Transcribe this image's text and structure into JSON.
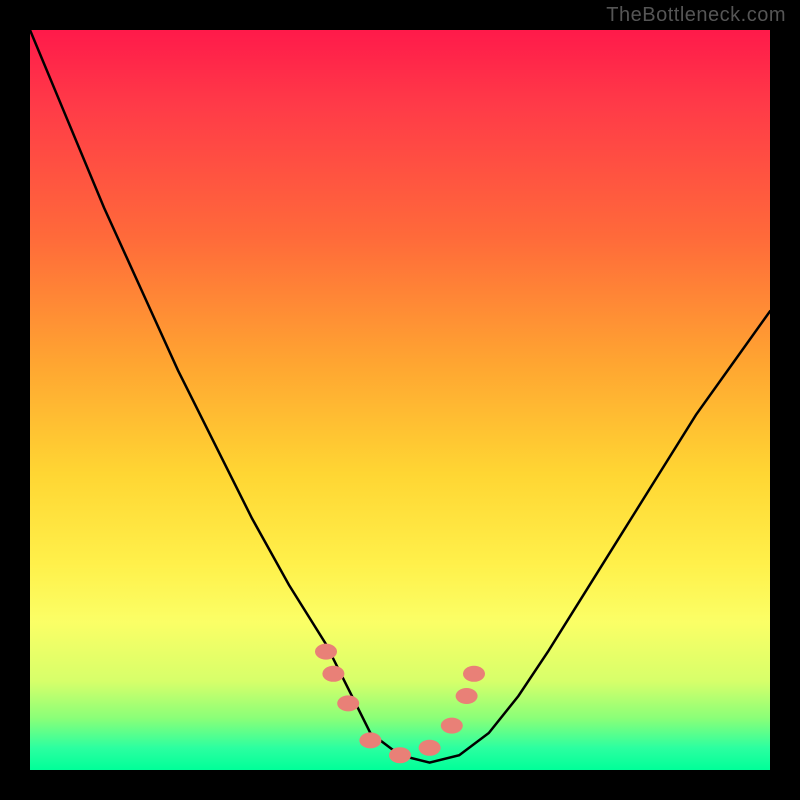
{
  "watermark": "TheBottleneck.com",
  "chart_data": {
    "type": "line",
    "title": "",
    "xlabel": "",
    "ylabel": "",
    "xlim": [
      0,
      100
    ],
    "ylim": [
      0,
      100
    ],
    "grid": false,
    "legend": false,
    "series": [
      {
        "name": "bottleneck-curve",
        "x": [
          0,
          5,
          10,
          15,
          20,
          25,
          30,
          35,
          40,
          43,
          46,
          50,
          54,
          58,
          62,
          66,
          70,
          75,
          80,
          85,
          90,
          95,
          100
        ],
        "values": [
          100,
          88,
          76,
          65,
          54,
          44,
          34,
          25,
          17,
          11,
          5,
          2,
          1,
          2,
          5,
          10,
          16,
          24,
          32,
          40,
          48,
          55,
          62
        ]
      }
    ],
    "markers": {
      "name": "highlight-points",
      "x": [
        40,
        41,
        43,
        46,
        50,
        54,
        57,
        59,
        60
      ],
      "values": [
        16,
        13,
        9,
        4,
        2,
        3,
        6,
        10,
        13
      ]
    },
    "gradient_stops": [
      {
        "pos": 0.0,
        "color": "#ff1a4a"
      },
      {
        "pos": 0.28,
        "color": "#ff6a3a"
      },
      {
        "pos": 0.6,
        "color": "#ffd633"
      },
      {
        "pos": 0.8,
        "color": "#fbff66"
      },
      {
        "pos": 0.95,
        "color": "#4cffa0"
      },
      {
        "pos": 1.0,
        "color": "#00ff99"
      }
    ]
  }
}
